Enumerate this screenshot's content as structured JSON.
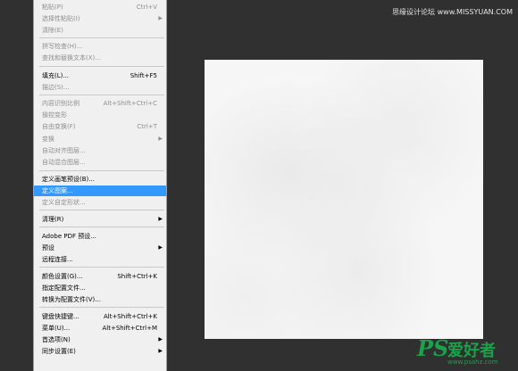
{
  "watermark_top": "思缘设计论坛 www.MISSYUAN.COM",
  "logo": {
    "ps": "PS",
    "cn": "爱好者",
    "url": "www.psahz.com"
  },
  "menu": {
    "items": [
      {
        "label": "粘贴(P)",
        "shortcut": "Ctrl+V",
        "disabled": true
      },
      {
        "label": "选择性粘贴(I)",
        "disabled": true,
        "submenu": true
      },
      {
        "label": "清除(E)",
        "disabled": true
      },
      {
        "label": "拼写检查(H)...",
        "disabled": true
      },
      {
        "label": "查找和替换文本(X)...",
        "disabled": true
      },
      {
        "label": "填充(L)...",
        "shortcut": "Shift+F5"
      },
      {
        "label": "描边(S)...",
        "disabled": true
      },
      {
        "label": "内容识别比例",
        "shortcut": "Alt+Shift+Ctrl+C",
        "disabled": true
      },
      {
        "label": "操控变形",
        "disabled": true
      },
      {
        "label": "自由变换(F)",
        "shortcut": "Ctrl+T",
        "disabled": true
      },
      {
        "label": "变换",
        "disabled": true,
        "submenu": true
      },
      {
        "label": "自动对齐图层...",
        "disabled": true
      },
      {
        "label": "自动混合图层...",
        "disabled": true
      },
      {
        "label": "定义画笔预设(B)..."
      },
      {
        "label": "定义图案...",
        "highlighted": true
      },
      {
        "label": "定义自定形状...",
        "disabled": true
      },
      {
        "label": "清理(R)",
        "submenu": true
      },
      {
        "label": "Adobe PDF 预设..."
      },
      {
        "label": "预设",
        "submenu": true
      },
      {
        "label": "远程连接..."
      },
      {
        "label": "颜色设置(G)...",
        "shortcut": "Shift+Ctrl+K"
      },
      {
        "label": "指定配置文件..."
      },
      {
        "label": "转换为配置文件(V)..."
      },
      {
        "label": "键盘快捷键...",
        "shortcut": "Alt+Shift+Ctrl+K"
      },
      {
        "label": "菜单(U)...",
        "shortcut": "Alt+Shift+Ctrl+M"
      },
      {
        "label": "首选项(N)",
        "submenu": true
      },
      {
        "label": "同步设置(E)",
        "submenu": true
      }
    ],
    "submenu_arrow": "▶"
  }
}
